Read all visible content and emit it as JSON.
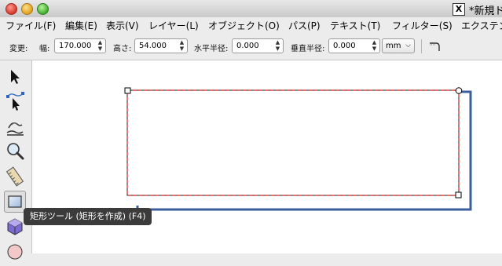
{
  "window": {
    "title": "*新規ド",
    "app_icon_label": "X"
  },
  "menu": {
    "items": [
      "ファイル(F)",
      "編集(E)",
      "表示(V)",
      "レイヤー(L)",
      "オブジェクト(O)",
      "パス(P)",
      "テキスト(T)",
      "フィルター(S)",
      "エクステン"
    ]
  },
  "controls": {
    "transform_label": "変更:",
    "width_label": "幅:",
    "width_value": "170.000",
    "height_label": "高さ:",
    "height_value": "54.000",
    "rx_label": "水平半径:",
    "rx_value": "0.000",
    "ry_label": "垂直半径:",
    "ry_value": "0.000",
    "unit": "mm"
  },
  "toolbox": {
    "tools": [
      "selector-icon",
      "node-editor-icon",
      "tweak-icon",
      "zoom-icon",
      "measure-icon",
      "rectangle-icon",
      "3d-box-icon",
      "ellipse-icon"
    ],
    "active_tool": "rectangle-icon"
  },
  "tooltip": {
    "text": "矩形ツール (矩形を作成) (F4)"
  },
  "colors": {
    "selection_dash": "#e21b1b",
    "rect_shadow": "#3a5f9c",
    "canvas_bg": "#ffffff"
  }
}
